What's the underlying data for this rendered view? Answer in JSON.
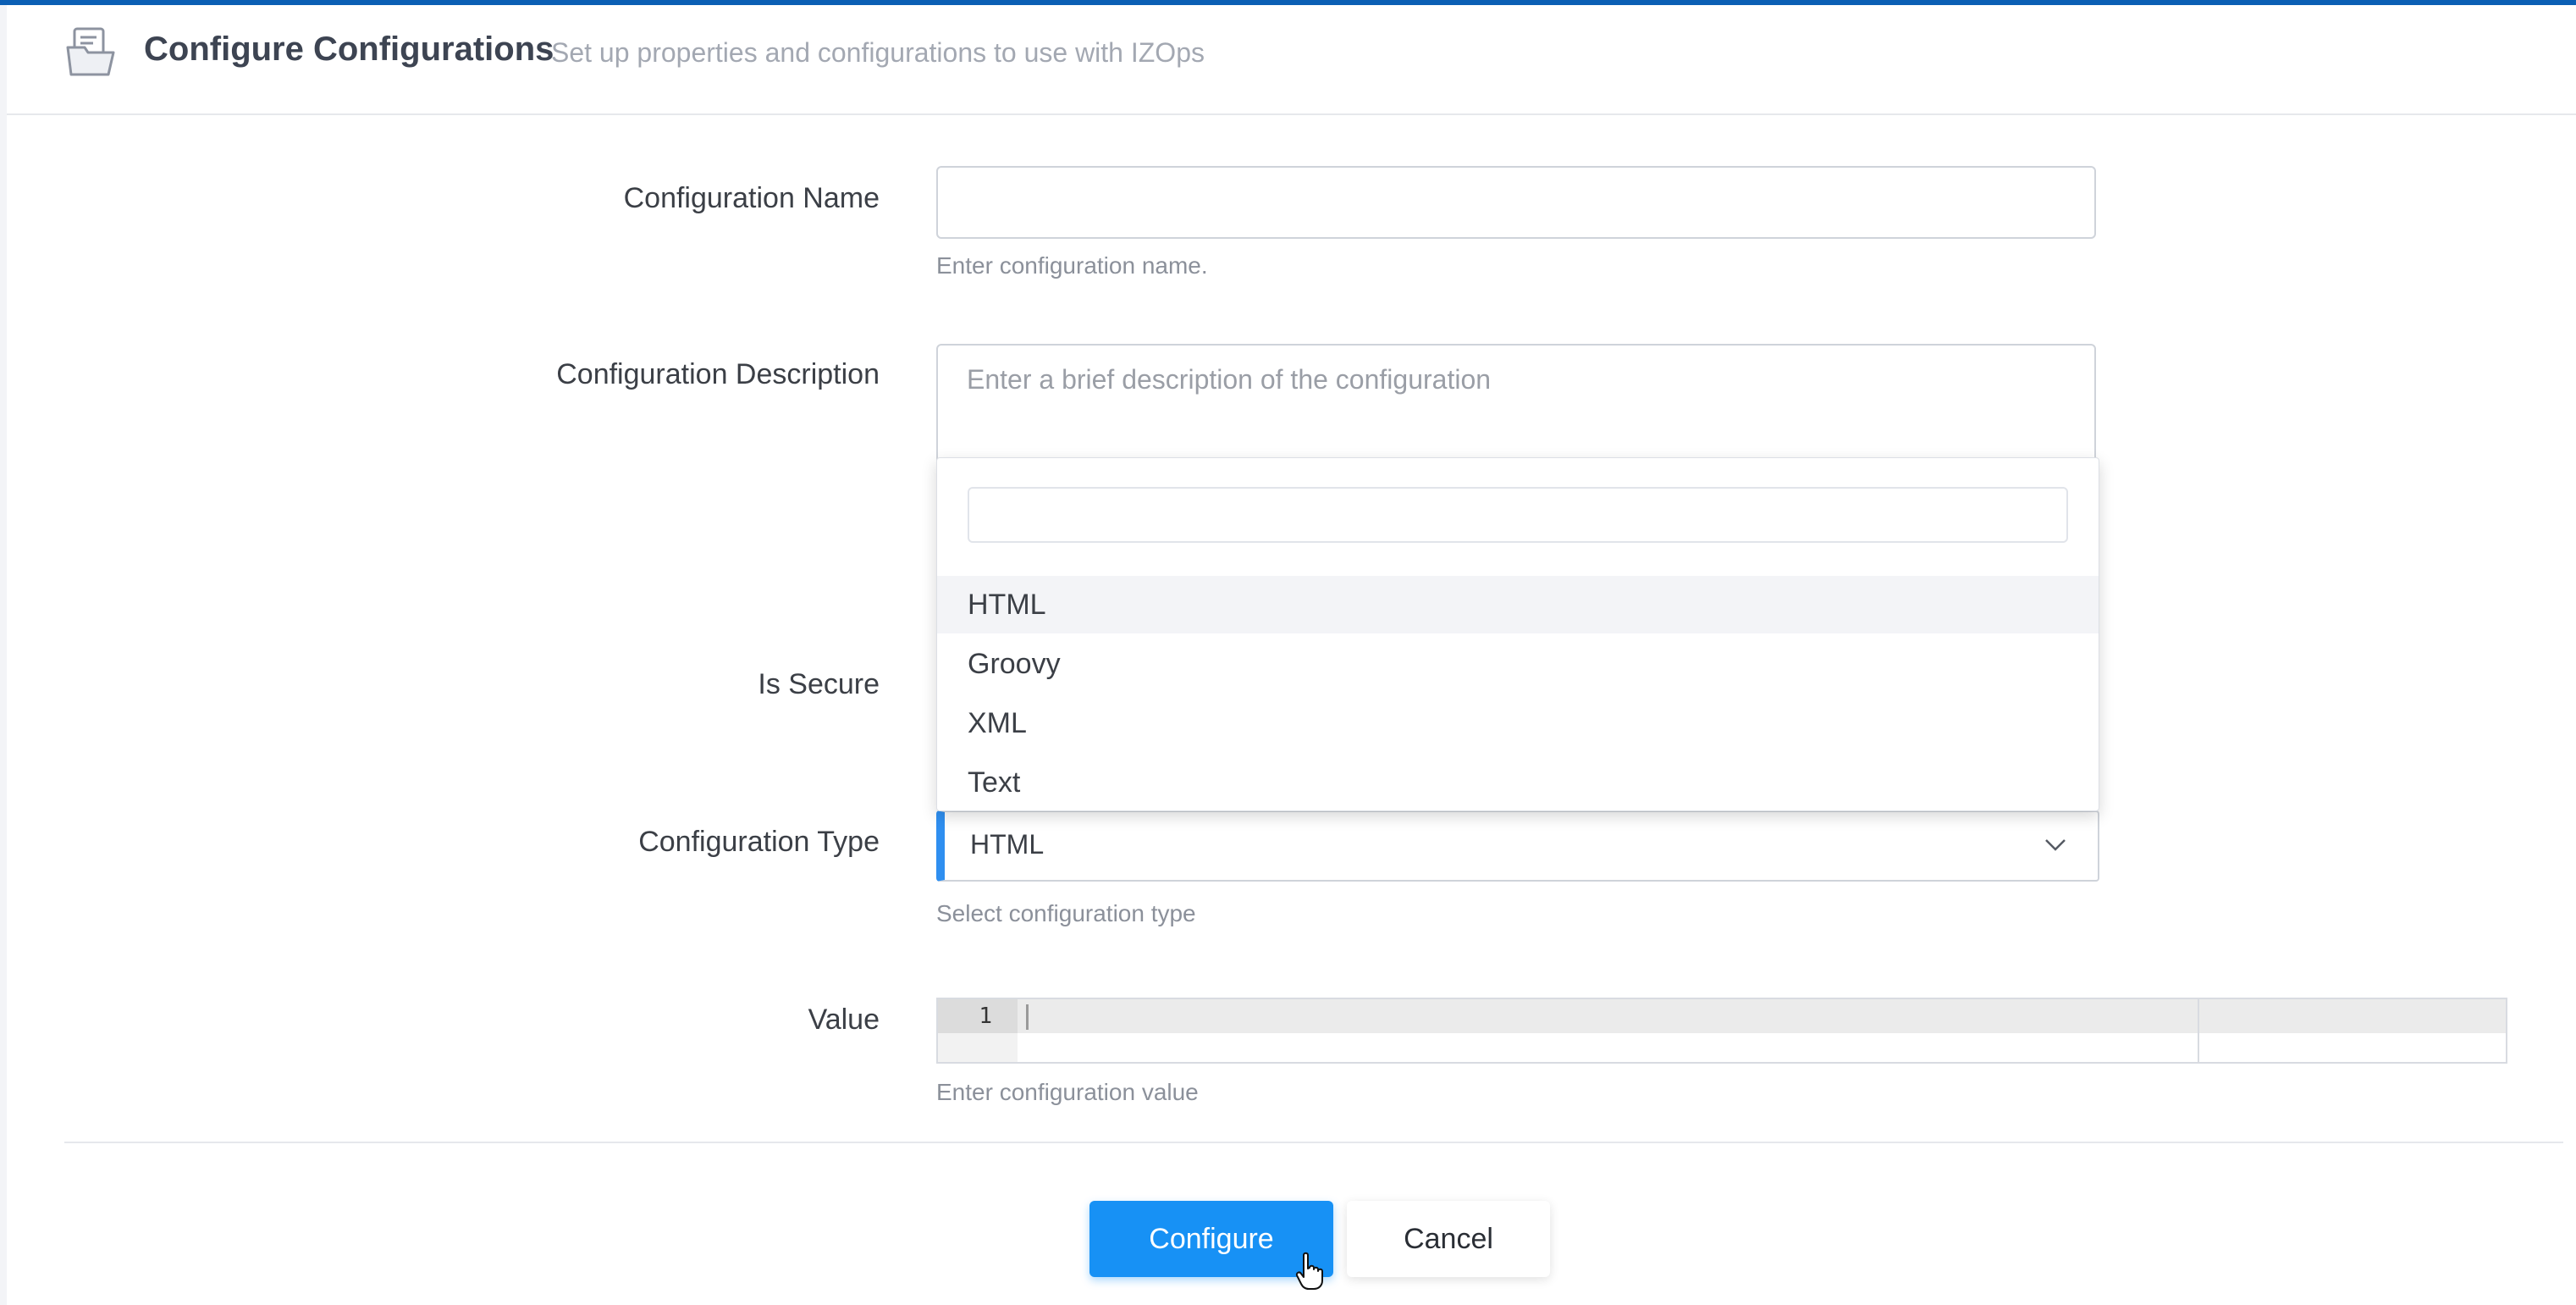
{
  "colors": {
    "accent": "#1791f5",
    "topbar": "#0b5fb4",
    "select_accent": "#2f8ff0"
  },
  "header": {
    "icon": "document-folder-icon",
    "title": "Configure Configurations",
    "subtitle": "Set up properties and configurations to use with IZOps"
  },
  "form": {
    "name": {
      "label": "Configuration Name",
      "value": "",
      "help": "Enter configuration name."
    },
    "description": {
      "label": "Configuration Description",
      "placeholder": "Enter a brief description of the configuration"
    },
    "is_secure": {
      "label": "Is Secure"
    },
    "type": {
      "label": "Configuration Type",
      "selected": "HTML",
      "help": "Select configuration type",
      "dropdown": {
        "search_value": "",
        "options": [
          "HTML",
          "Groovy",
          "XML",
          "Text"
        ],
        "highlighted": "HTML"
      }
    },
    "value": {
      "label": "Value",
      "line_number": "1",
      "help": "Enter configuration value"
    }
  },
  "actions": {
    "configure": "Configure",
    "cancel": "Cancel"
  },
  "cursor_icon": "hand-pointer-icon"
}
